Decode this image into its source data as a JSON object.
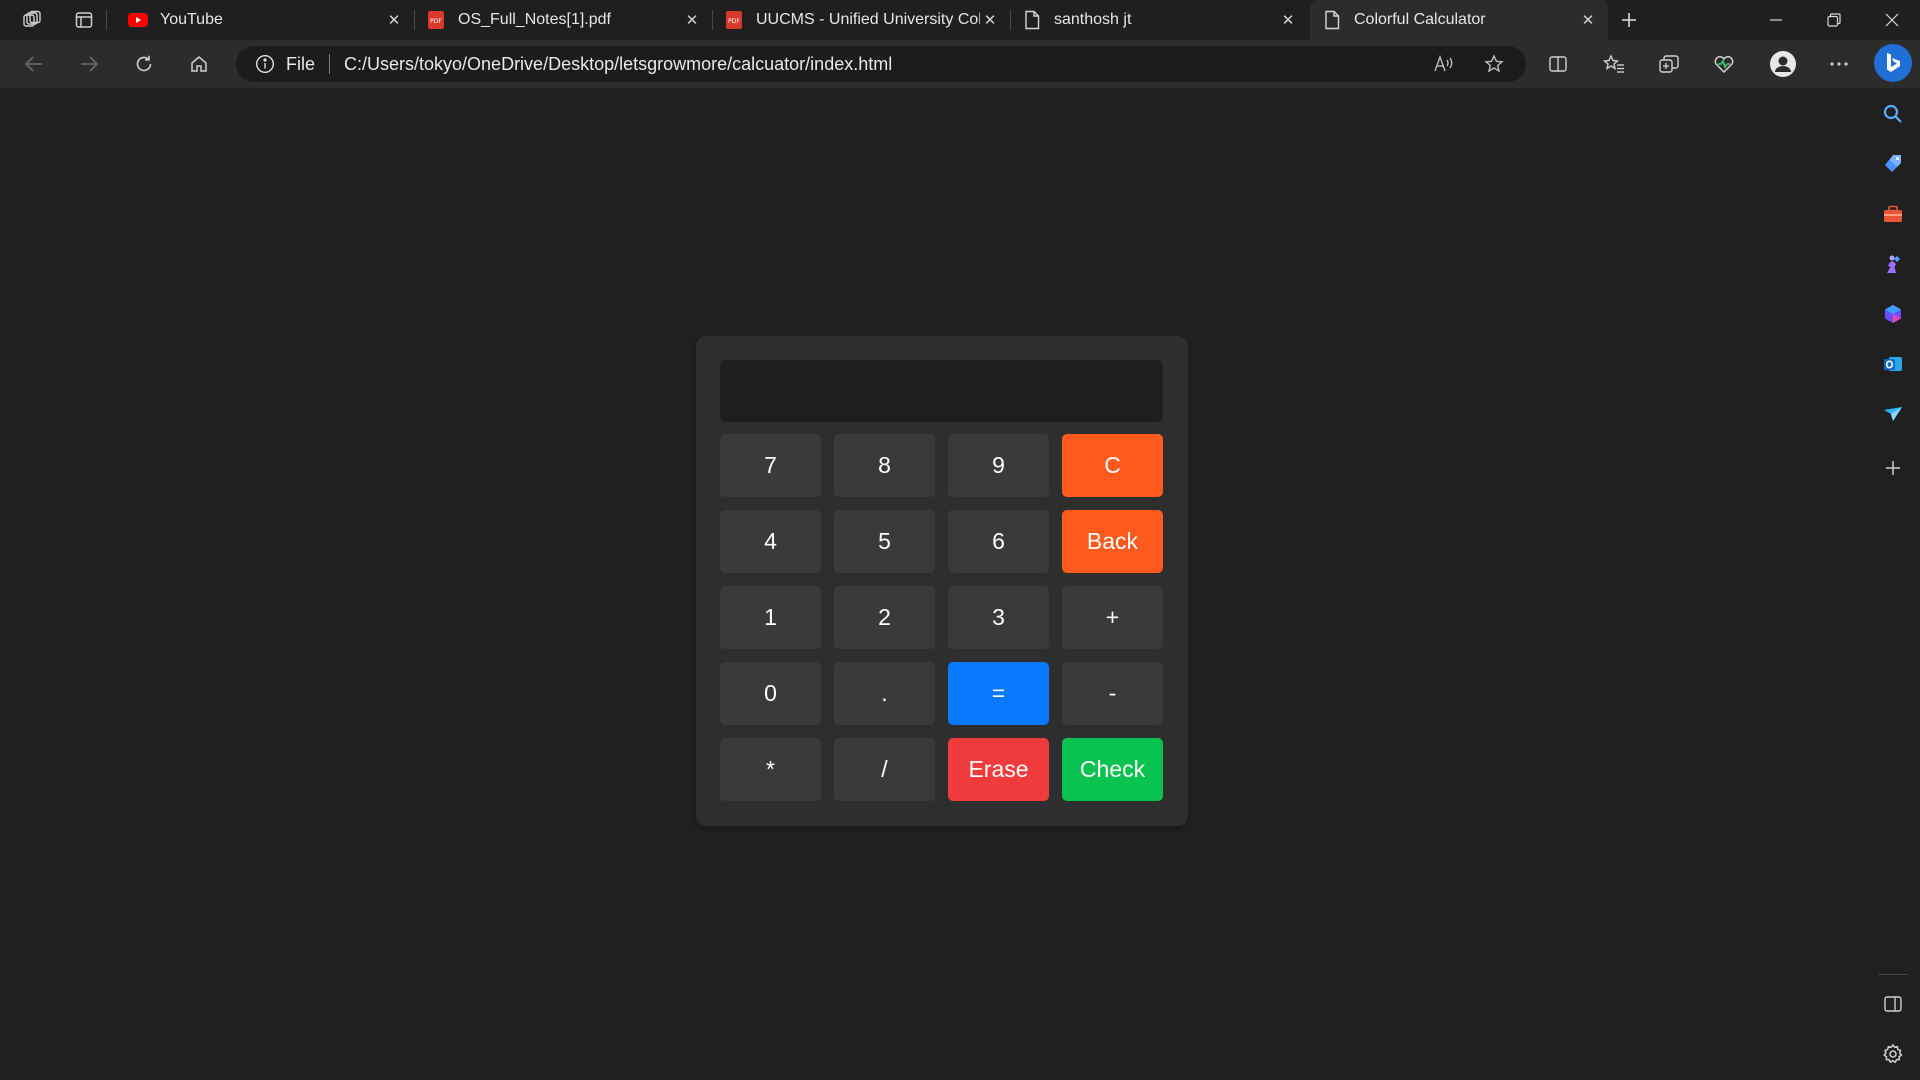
{
  "browser": {
    "tabs": [
      {
        "title": "YouTube",
        "icon": "youtube-icon",
        "active": false
      },
      {
        "title": "OS_Full_Notes[1].pdf",
        "icon": "pdf-icon",
        "active": false
      },
      {
        "title": "UUCMS - Unified University Colle",
        "icon": "pdf-icon",
        "active": false
      },
      {
        "title": "santhosh jt",
        "icon": "file-icon",
        "active": false
      },
      {
        "title": "Colorful Calculator",
        "icon": "file-icon",
        "active": true
      }
    ],
    "address": {
      "scheme_label": "File",
      "url": "C:/Users/tokyo/OneDrive/Desktop/letsgrowmore/calcuator/index.html"
    }
  },
  "calculator": {
    "display_value": "",
    "keys": [
      {
        "label": "7",
        "style": "default"
      },
      {
        "label": "8",
        "style": "default"
      },
      {
        "label": "9",
        "style": "default"
      },
      {
        "label": "C",
        "style": "orange"
      },
      {
        "label": "4",
        "style": "default"
      },
      {
        "label": "5",
        "style": "default"
      },
      {
        "label": "6",
        "style": "default"
      },
      {
        "label": "Back",
        "style": "orange"
      },
      {
        "label": "1",
        "style": "default"
      },
      {
        "label": "2",
        "style": "default"
      },
      {
        "label": "3",
        "style": "default"
      },
      {
        "label": "+",
        "style": "default"
      },
      {
        "label": "0",
        "style": "default"
      },
      {
        "label": ".",
        "style": "default"
      },
      {
        "label": "=",
        "style": "blue"
      },
      {
        "label": "-",
        "style": "default"
      },
      {
        "label": "*",
        "style": "default"
      },
      {
        "label": "/",
        "style": "default"
      },
      {
        "label": "Erase",
        "style": "red"
      },
      {
        "label": "Check",
        "style": "green"
      }
    ]
  },
  "colors": {
    "orange": "#ff5a1e",
    "blue": "#0a78ff",
    "red": "#ef3b3b",
    "green": "#0ac24f",
    "key_default": "#3a3a3a"
  }
}
